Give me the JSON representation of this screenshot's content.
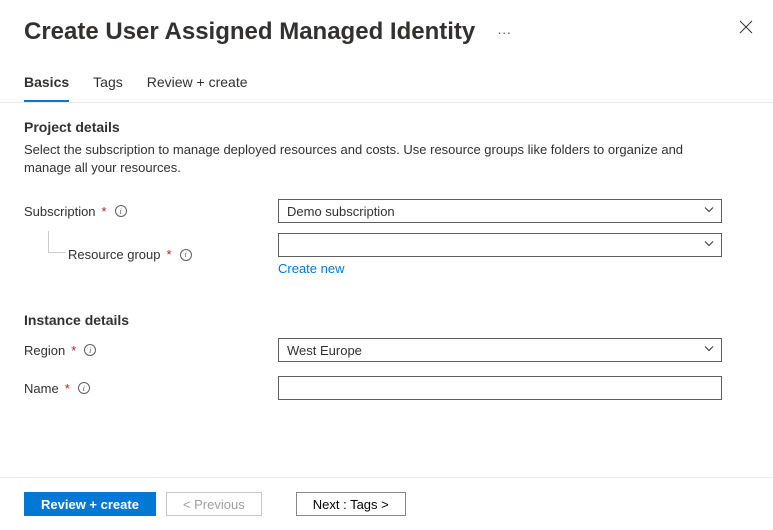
{
  "header": {
    "title": "Create User Assigned Managed Identity"
  },
  "tabs": {
    "basics": "Basics",
    "tags": "Tags",
    "review": "Review + create"
  },
  "project": {
    "section_title": "Project details",
    "description": "Select the subscription to manage deployed resources and costs. Use resource groups like folders to organize and manage all your resources.",
    "subscription_label": "Subscription",
    "subscription_value": "Demo subscription",
    "resource_group_label": "Resource group",
    "resource_group_value": "",
    "create_new": "Create new"
  },
  "instance": {
    "section_title": "Instance details",
    "region_label": "Region",
    "region_value": "West Europe",
    "name_label": "Name",
    "name_value": ""
  },
  "footer": {
    "review": "Review + create",
    "previous": "< Previous",
    "next": "Next : Tags >"
  }
}
